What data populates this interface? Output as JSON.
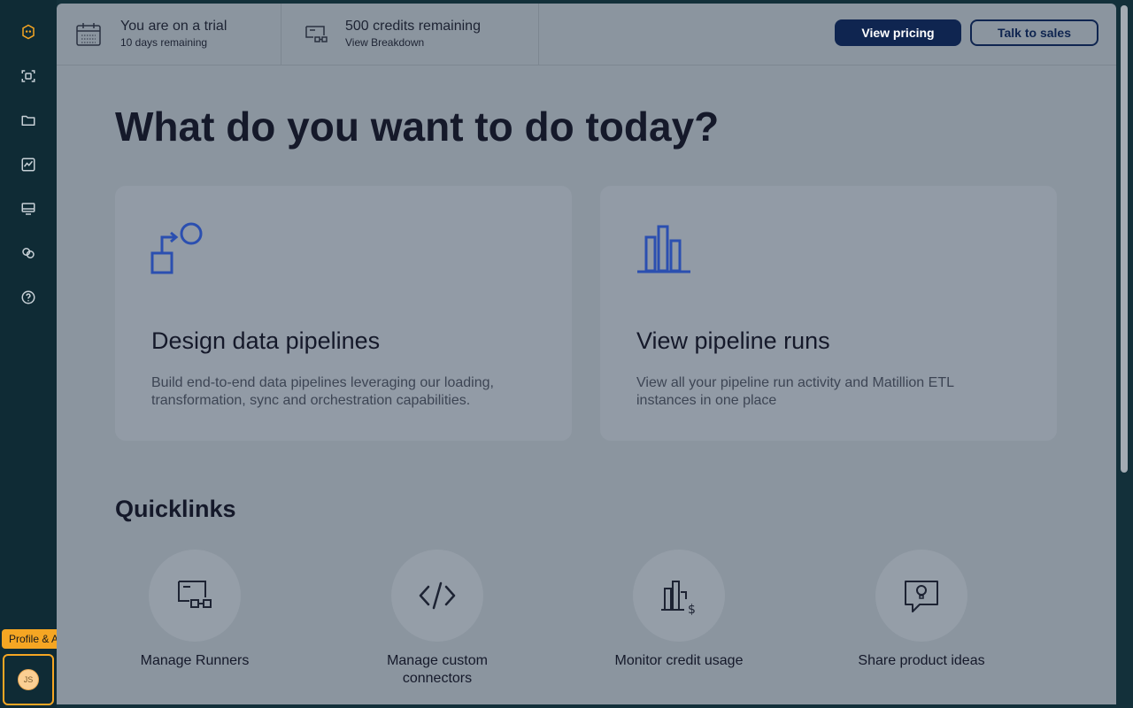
{
  "sidebar": {
    "items": [
      {
        "icon": "logo-icon"
      },
      {
        "icon": "scan-icon"
      },
      {
        "icon": "folder-icon"
      },
      {
        "icon": "activity-chart-icon"
      },
      {
        "icon": "monitor-icon"
      },
      {
        "icon": "link-icon"
      },
      {
        "icon": "help-icon"
      }
    ],
    "avatar_initials": "JS",
    "tooltip": "Profile & Account"
  },
  "topbar": {
    "trial": {
      "title": "You are on a trial",
      "subtitle": "10 days remaining"
    },
    "credits": {
      "title": "500 credits remaining",
      "subtitle": "View Breakdown"
    },
    "view_pricing": "View pricing",
    "talk_to_sales": "Talk to sales"
  },
  "main": {
    "heading": "What do you want to do today?",
    "cards": [
      {
        "title": "Design data pipelines",
        "description": "Build end-to-end data pipelines leveraging our loading, transformation, sync and orchestration capabilities."
      },
      {
        "title": "View pipeline runs",
        "description": "View all your pipeline run activity and Matillion ETL instances in one place"
      }
    ],
    "quicklinks_title": "Quicklinks",
    "quicklinks": [
      {
        "label": "Manage Runners"
      },
      {
        "label": "Manage custom connectors"
      },
      {
        "label": "Monitor credit usage"
      },
      {
        "label": "Share product ideas"
      }
    ]
  },
  "colors": {
    "sidebar_bg": "#0f2b35",
    "accent": "#f5a623",
    "primary_button": "#0f2550",
    "icon_blue": "#2b4fb0"
  }
}
